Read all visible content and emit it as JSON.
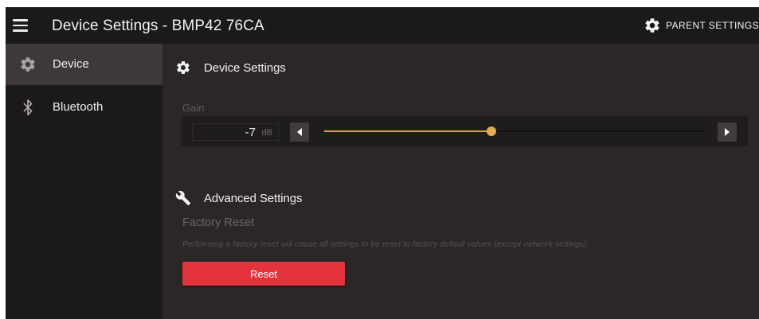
{
  "header": {
    "title": "Device Settings - BMP42 76CA",
    "parent_settings_label": "PARENT SETTINGS"
  },
  "sidebar": {
    "items": [
      {
        "label": "Device",
        "icon": "gear-icon",
        "active": true
      },
      {
        "label": "Bluetooth",
        "icon": "bluetooth-icon",
        "active": false
      }
    ]
  },
  "device_settings": {
    "title": "Device Settings",
    "gain": {
      "label": "Gain",
      "value": "-7",
      "unit": "dB",
      "slider_level": 0.44
    }
  },
  "advanced_settings": {
    "title": "Advanced Settings",
    "factory_reset": {
      "title": "Factory Reset",
      "description": "Performing a factory reset will cause all settings to be reset to factory default values (except network settings).",
      "button_label": "Reset"
    }
  },
  "colors": {
    "accent": "#e0ac4f",
    "danger": "#e3343e",
    "sidebar_bg": "#1b1a19",
    "main_bg": "#2a2726"
  }
}
